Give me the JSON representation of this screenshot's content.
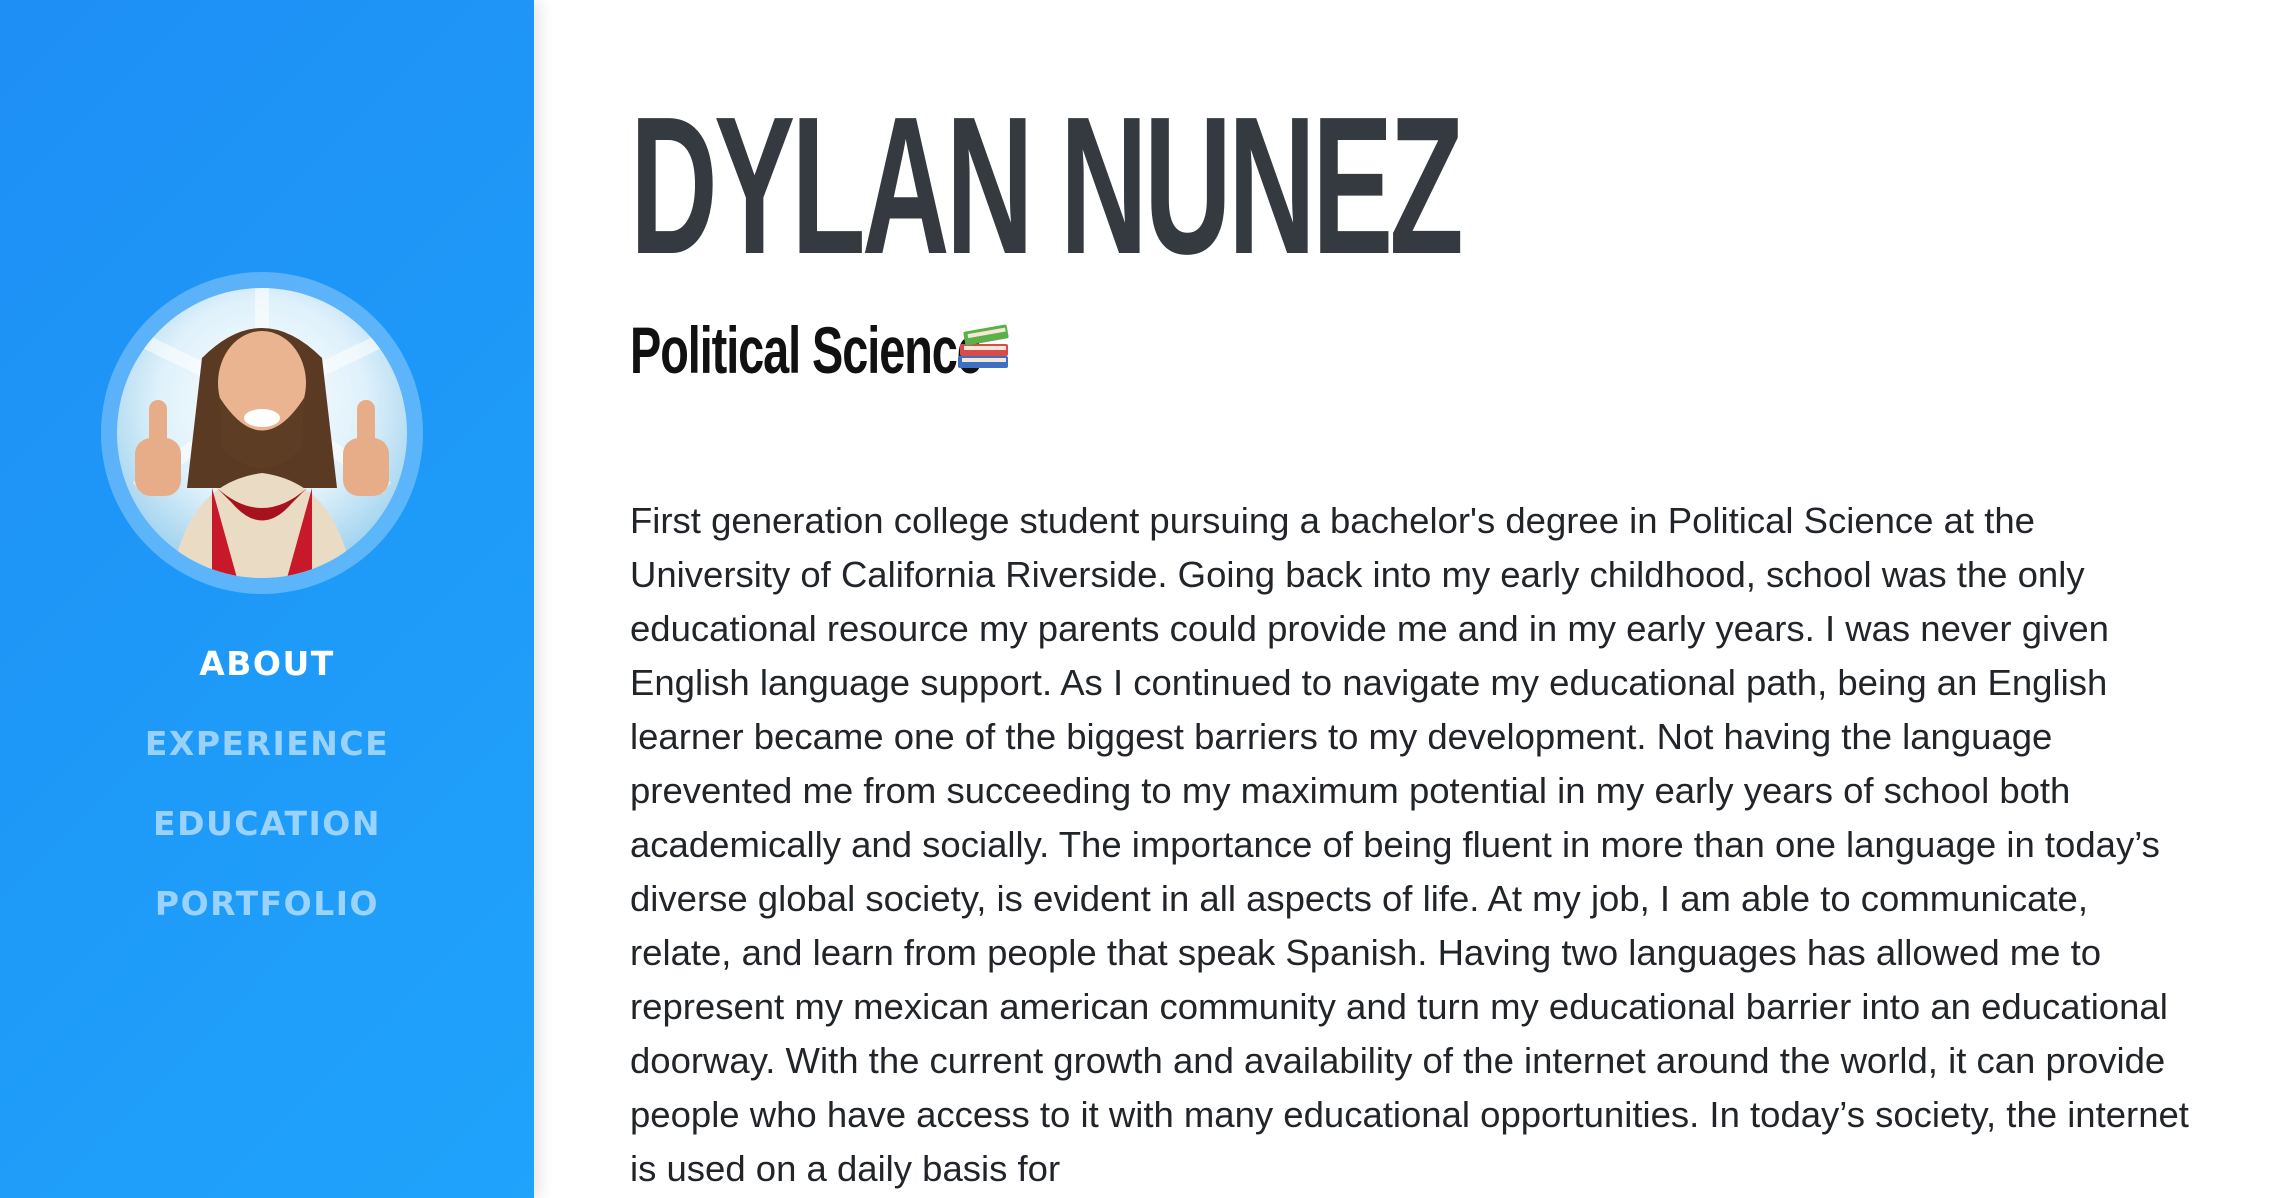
{
  "sidebar": {
    "colors": {
      "background": "#1e8ff5",
      "nav_inactive": "#a7d4fc",
      "nav_active": "#ffffff"
    },
    "nav": [
      {
        "label": "ABOUT",
        "active": true
      },
      {
        "label": "EXPERIENCE",
        "active": false
      },
      {
        "label": "EDUCATION",
        "active": false
      },
      {
        "label": "PORTFOLIO",
        "active": false
      }
    ]
  },
  "main": {
    "name": "DYLAN NUNEZ",
    "subtitle": "Political Science",
    "subtitle_icon": "books-icon",
    "about": "First generation college student pursuing a bachelor's degree in Political Science at the University of California Riverside. Going back into my early childhood, school was the only educational resource my parents could provide me and in my early years. I was never given English language support. As I continued to navigate my educational path, being an English learner became one of the biggest barriers to my development. Not having the language prevented me from succeeding to my maximum potential in my early years of school both academically and socially. The importance of being fluent in more than one language in today’s diverse global society, is evident in all aspects of life. At my job, I am able to communicate, relate, and learn from people that speak Spanish. Having two languages has allowed me to represent my mexican american community and turn my educational barrier into an educational doorway. With the current growth and availability of the internet around the world, it can provide people who have access to it with many educational opportunities. In today’s society, the internet is used on a daily basis for"
  }
}
